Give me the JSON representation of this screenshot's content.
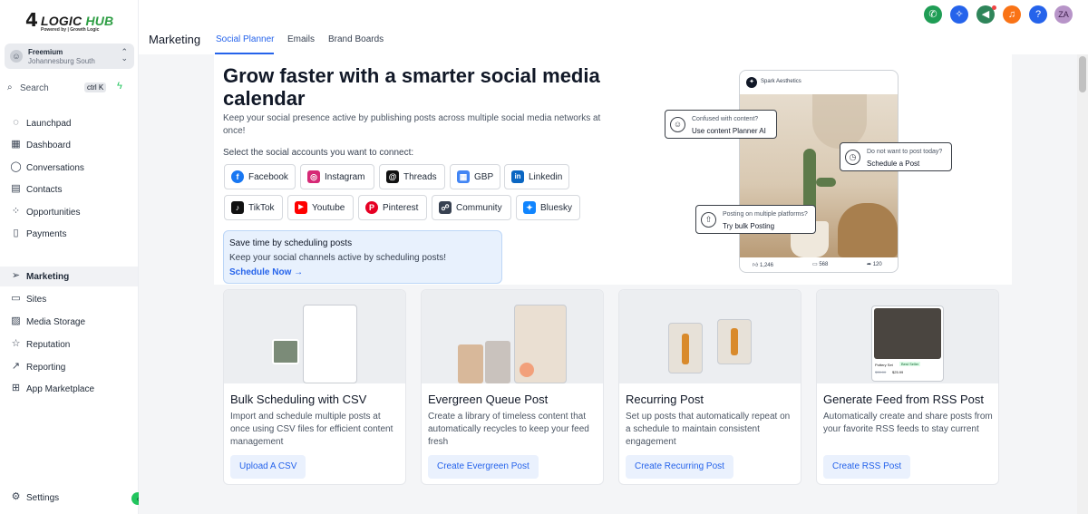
{
  "brand": {
    "logo_text": "LOGIC",
    "logo_hub": "HUB",
    "logo_tagline": "Powered by | Growth Logic"
  },
  "account": {
    "name": "Freemium",
    "location": "Johannesburg South"
  },
  "search": {
    "label": "Search",
    "shortcut": "ctrl K"
  },
  "sidebar": {
    "items": [
      {
        "label": "Launchpad",
        "icon": "rocket-icon"
      },
      {
        "label": "Dashboard",
        "icon": "dashboard-icon"
      },
      {
        "label": "Conversations",
        "icon": "chat-icon"
      },
      {
        "label": "Contacts",
        "icon": "contacts-icon"
      },
      {
        "label": "Opportunities",
        "icon": "opportunities-icon"
      },
      {
        "label": "Payments",
        "icon": "payments-icon"
      },
      {
        "label": "Marketing",
        "icon": "send-icon"
      },
      {
        "label": "Sites",
        "icon": "sites-icon"
      },
      {
        "label": "Media Storage",
        "icon": "image-icon"
      },
      {
        "label": "Reputation",
        "icon": "star-icon"
      },
      {
        "label": "Reporting",
        "icon": "trend-icon"
      },
      {
        "label": "App Marketplace",
        "icon": "grid-icon"
      }
    ],
    "settings": "Settings"
  },
  "header": {
    "title": "Marketing",
    "tabs": [
      {
        "label": "Social Planner"
      },
      {
        "label": "Emails"
      },
      {
        "label": "Brand Boards"
      }
    ],
    "avatar": "ZA",
    "icons": [
      "phone-icon",
      "magic-icon",
      "megaphone-icon",
      "bell-icon",
      "help-icon"
    ]
  },
  "hero": {
    "title": "Grow faster with a smarter social media calendar",
    "description": "Keep your social presence active by publishing posts across multiple social media networks at once!",
    "select_label": "Select the social accounts you want to connect:"
  },
  "networks": [
    {
      "label": "Facebook",
      "glyph": "f",
      "color": "#1877f2"
    },
    {
      "label": "Instagram",
      "glyph": "◎",
      "color": "#d62976"
    },
    {
      "label": "Threads",
      "glyph": "@",
      "color": "#111111"
    },
    {
      "label": "GBP",
      "glyph": "▦",
      "color": "#4285f4"
    },
    {
      "label": "Linkedin",
      "glyph": "in",
      "color": "#0a66c2"
    },
    {
      "label": "TikTok",
      "glyph": "♪",
      "color": "#111111"
    },
    {
      "label": "Youtube",
      "glyph": "▶",
      "color": "#ff0000"
    },
    {
      "label": "Pinterest",
      "glyph": "P",
      "color": "#e60023"
    },
    {
      "label": "Community",
      "glyph": "☍",
      "color": "#374151"
    },
    {
      "label": "Bluesky",
      "glyph": "✦",
      "color": "#1185fe"
    }
  ],
  "promo": {
    "title": "Save time by scheduling posts",
    "description": "Keep your social channels active by scheduling posts!",
    "link": "Schedule Now →"
  },
  "preview": {
    "brand": "Spark Aesthetics",
    "likes": "1,246",
    "comments": "568",
    "shares": "120",
    "callouts": [
      {
        "line1": "Confused with content?",
        "line2": "Use content Planner AI"
      },
      {
        "line1": "Do not want to post today?",
        "line2": "Schedule a Post"
      },
      {
        "line1": "Posting on multiple platforms?",
        "line2": "Try bulk Posting"
      }
    ]
  },
  "cards": [
    {
      "title": "Bulk Scheduling with CSV",
      "description": "Import and schedule multiple posts at once using CSV files for efficient content management",
      "button": "Upload A CSV"
    },
    {
      "title": "Evergreen Queue Post",
      "description": "Create a library of timeless content that automatically recycles to keep your feed fresh",
      "button": "Create Evergreen Post"
    },
    {
      "title": "Recurring Post",
      "description": "Set up posts that automatically repeat on a schedule to maintain consistent engagement",
      "button": "Create Recurring Post"
    },
    {
      "title": "Generate Feed from RSS Post",
      "description": "Automatically create and share posts from your favorite RSS feeds to stay current",
      "button": "Create RSS Post"
    }
  ],
  "rss_art": {
    "product": "Pottery Set",
    "badge": "Best Seller",
    "old_price": "$35.00",
    "price": "$25.99"
  },
  "colors": {
    "accent": "#2563eb",
    "brand_green": "#2e9e44"
  }
}
